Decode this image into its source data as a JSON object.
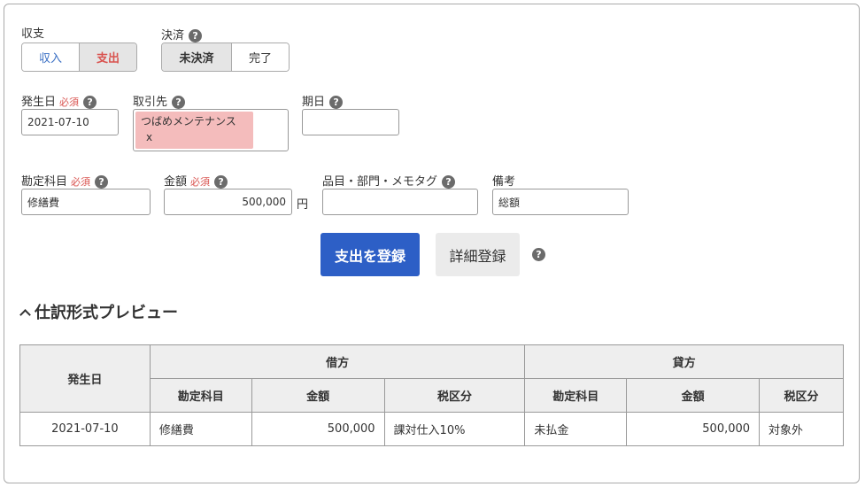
{
  "type_group": {
    "label": "収支",
    "options": [
      "収入",
      "支出"
    ],
    "selected": "支出"
  },
  "settlement_group": {
    "label": "決済",
    "options": [
      "未決済",
      "完了"
    ],
    "selected": "未決済"
  },
  "issue_date": {
    "label": "発生日",
    "required": "必須",
    "value": "2021-07-10"
  },
  "partner": {
    "label": "取引先",
    "tag": "つばめメンテナンス",
    "remove": "x"
  },
  "due_date": {
    "label": "期日",
    "value": ""
  },
  "account_item": {
    "label": "勘定科目",
    "required": "必須",
    "value": "修繕費"
  },
  "amount": {
    "label": "金額",
    "required": "必須",
    "value": "500,000",
    "unit": "円"
  },
  "item_tags": {
    "label": "品目・部門・メモタグ",
    "value": ""
  },
  "remarks": {
    "label": "備考",
    "value": "総額"
  },
  "help_glyph": "?",
  "buttons": {
    "register": "支出を登録",
    "detail": "詳細登録"
  },
  "preview": {
    "title": "仕訳形式プレビュー",
    "headers": {
      "date": "発生日",
      "debit": "借方",
      "credit": "貸方",
      "account": "勘定科目",
      "amount": "金額",
      "tax": "税区分"
    },
    "row": {
      "date": "2021-07-10",
      "debit_account": "修繕費",
      "debit_amount": "500,000",
      "debit_tax": "課対仕入10%",
      "credit_account": "未払金",
      "credit_amount": "500,000",
      "credit_tax": "対象外"
    }
  },
  "colors": {
    "primary": "#2d5fc6",
    "income_text": "#3a6fc4",
    "expense_text": "#d9534f",
    "required": "#d9534f",
    "tag_bg": "#f4bcbc"
  }
}
